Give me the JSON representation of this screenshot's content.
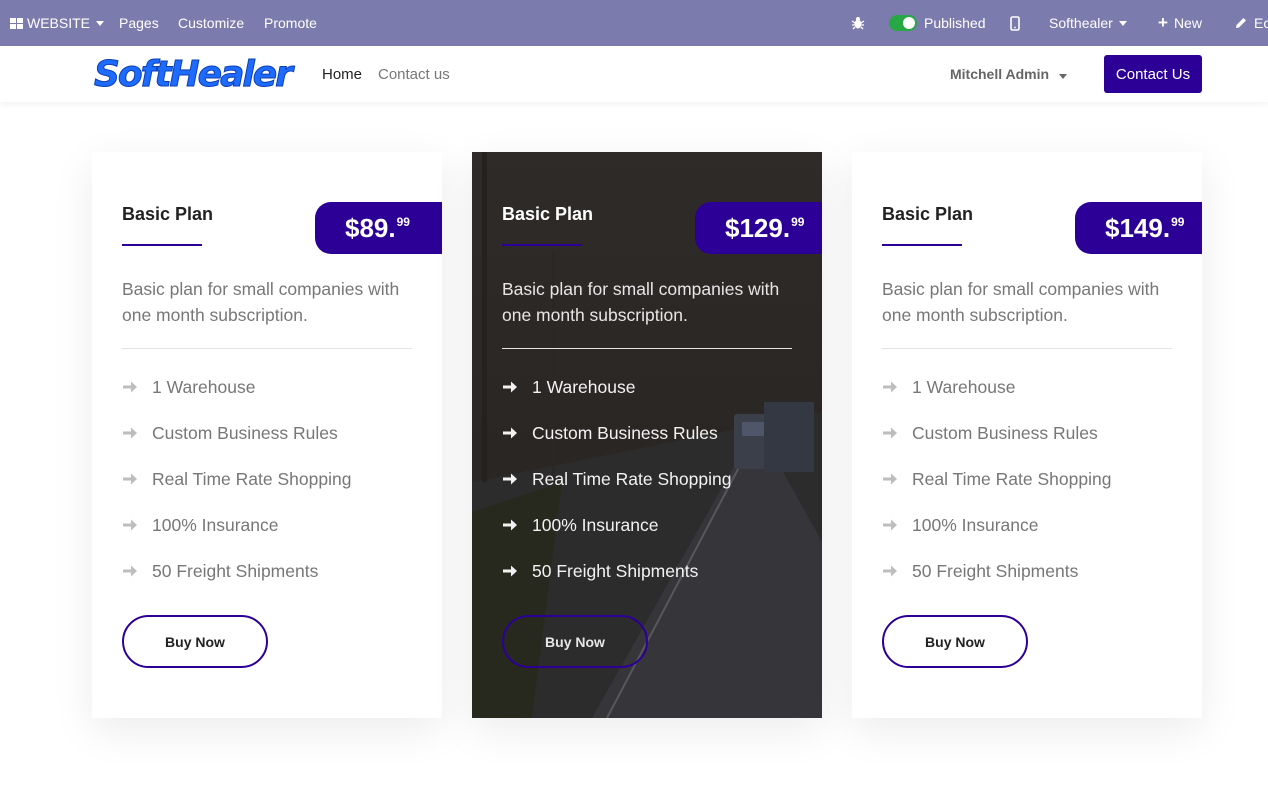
{
  "adminbar": {
    "website_label": "WEBSITE",
    "pages_label": "Pages",
    "customize_label": "Customize",
    "promote_label": "Promote",
    "published_label": "Published",
    "company_label": "Softhealer",
    "new_label": "New",
    "edit_label": "Ec"
  },
  "navbar": {
    "logo_text": "SoftHealer",
    "home_label": "Home",
    "contact_label": "Contact us",
    "user_name": "Mitchell Admin",
    "contact_button": "Contact Us"
  },
  "plans": [
    {
      "title": "Basic Plan",
      "price_main": "$89.",
      "price_cents": "99",
      "description": "Basic plan for small companies with one month subscription.",
      "features": [
        "1 Warehouse",
        "Custom Business Rules",
        "Real Time Rate Shopping",
        "100% Insurance",
        "50 Freight Shipments"
      ],
      "button": "Buy Now"
    },
    {
      "title": "Basic Plan",
      "price_main": "$129.",
      "price_cents": "99",
      "description": "Basic plan for small companies with one month subscription.",
      "features": [
        "1 Warehouse",
        "Custom Business Rules",
        "Real Time Rate Shopping",
        "100% Insurance",
        "50 Freight Shipments"
      ],
      "button": "Buy Now"
    },
    {
      "title": "Basic Plan",
      "price_main": "$149.",
      "price_cents": "99",
      "description": "Basic plan for small companies with one month subscription.",
      "features": [
        "1 Warehouse",
        "Custom Business Rules",
        "Real Time Rate Shopping",
        "100% Insurance",
        "50 Freight Shipments"
      ],
      "button": "Buy Now"
    }
  ],
  "colors": {
    "admin_bar": "#7c7bad",
    "primary": "#2c0096",
    "published_toggle": "#28a745",
    "featured_card_bg": "#2b2724"
  }
}
